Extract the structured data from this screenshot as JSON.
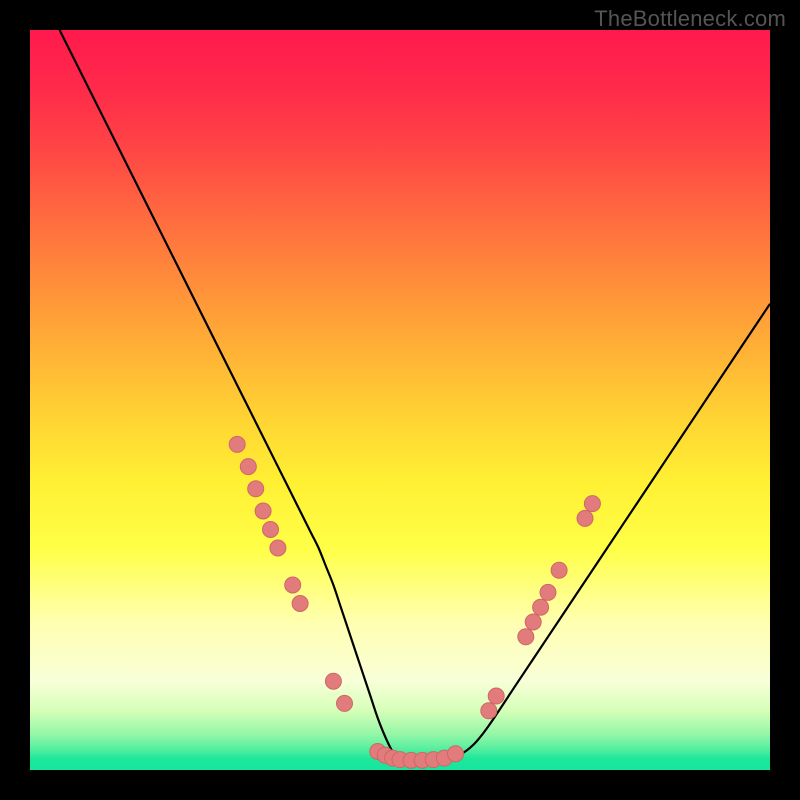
{
  "watermark": "TheBottleneck.com",
  "colors": {
    "curve": "#000000",
    "marker_fill": "#e27c7c",
    "marker_stroke": "#d06666",
    "gradient_top": "#ff1a4d",
    "gradient_bottom": "#15e6a0",
    "frame": "#000000"
  },
  "chart_data": {
    "type": "line",
    "title": "",
    "xlabel": "",
    "ylabel": "",
    "xlim": [
      0,
      100
    ],
    "ylim": [
      0,
      100
    ],
    "grid": false,
    "legend": false,
    "series": [
      {
        "name": "bottleneck_curve",
        "x": [
          4,
          8,
          12,
          16,
          20,
          24,
          28,
          30,
          32,
          34,
          36,
          38,
          39,
          40,
          41,
          42,
          43,
          44,
          45,
          46,
          47,
          48,
          49,
          50,
          52,
          54,
          56,
          58,
          60,
          62,
          66,
          70,
          74,
          78,
          82,
          86,
          90,
          94,
          98,
          100
        ],
        "values": [
          100,
          92,
          84,
          76,
          68,
          60,
          52,
          48,
          44,
          40,
          36,
          32,
          30,
          27.5,
          25,
          22,
          19,
          16,
          13,
          10,
          7,
          4.5,
          2.5,
          1.5,
          1.3,
          1.3,
          1.4,
          2,
          3.5,
          6,
          12,
          18,
          24,
          30,
          36,
          42,
          48,
          54,
          60,
          63
        ]
      }
    ],
    "markers": [
      {
        "x": 28.0,
        "y": 44.0
      },
      {
        "x": 29.5,
        "y": 41.0
      },
      {
        "x": 30.5,
        "y": 38.0
      },
      {
        "x": 31.5,
        "y": 35.0
      },
      {
        "x": 32.5,
        "y": 32.5
      },
      {
        "x": 33.5,
        "y": 30.0
      },
      {
        "x": 35.5,
        "y": 25.0
      },
      {
        "x": 36.5,
        "y": 22.5
      },
      {
        "x": 41.0,
        "y": 12.0
      },
      {
        "x": 42.5,
        "y": 9.0
      },
      {
        "x": 47.0,
        "y": 2.5
      },
      {
        "x": 48.0,
        "y": 2.0
      },
      {
        "x": 49.0,
        "y": 1.6
      },
      {
        "x": 50.0,
        "y": 1.4
      },
      {
        "x": 51.5,
        "y": 1.3
      },
      {
        "x": 53.0,
        "y": 1.3
      },
      {
        "x": 54.5,
        "y": 1.4
      },
      {
        "x": 56.0,
        "y": 1.6
      },
      {
        "x": 57.5,
        "y": 2.2
      },
      {
        "x": 62.0,
        "y": 8.0
      },
      {
        "x": 63.0,
        "y": 10.0
      },
      {
        "x": 67.0,
        "y": 18.0
      },
      {
        "x": 68.0,
        "y": 20.0
      },
      {
        "x": 69.0,
        "y": 22.0
      },
      {
        "x": 70.0,
        "y": 24.0
      },
      {
        "x": 71.5,
        "y": 27.0
      },
      {
        "x": 75.0,
        "y": 34.0
      },
      {
        "x": 76.0,
        "y": 36.0
      }
    ]
  }
}
